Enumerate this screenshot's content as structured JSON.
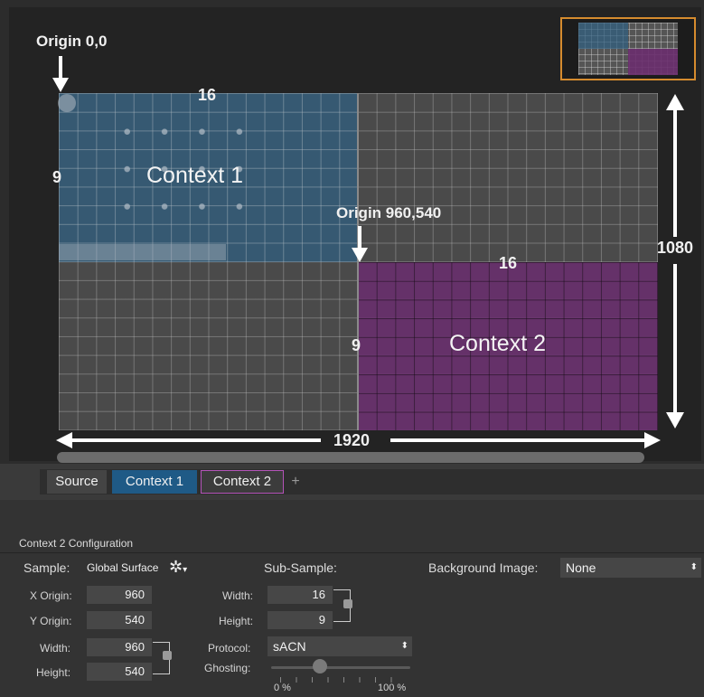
{
  "annotations": {
    "origin_top": "Origin 0,0",
    "origin_mid": "Origin 960,540",
    "ctx1_cols": "16",
    "ctx1_rows": "9",
    "ctx1_label": "Context 1",
    "ctx2_cols": "16",
    "ctx2_rows": "9",
    "ctx2_label": "Context 2",
    "height_label": "1080",
    "width_label": "1920"
  },
  "colors": {
    "context1": "#2f5f82",
    "context2": "#6a2d6e",
    "accent_tab1": "#1f5a86",
    "accent_tab2": "#b453b8"
  },
  "tabs": [
    "Source",
    "Context 1",
    "Context 2"
  ],
  "add_tab_icon": "plus-icon",
  "config": {
    "title": "Context 2 Configuration",
    "sample_label": "Sample:",
    "sample_value": "Global Surface",
    "sample_icon": "gear-icon",
    "subsample_label": "Sub-Sample:",
    "bg_image_label": "Background Image:",
    "bg_image_value": "None",
    "x_origin_label": "X Origin:",
    "x_origin_value": "960",
    "y_origin_label": "Y Origin:",
    "y_origin_value": "540",
    "width_label": "Width:",
    "width_value": "960",
    "height_label": "Height:",
    "height_value": "540",
    "sub_width_label": "Width:",
    "sub_width_value": "16",
    "sub_height_label": "Height:",
    "sub_height_value": "9",
    "protocol_label": "Protocol:",
    "protocol_value": "sACN",
    "ghosting_label": "Ghosting:",
    "ghosting_min": "0 %",
    "ghosting_max": "100 %",
    "ghosting_level": 0.35
  }
}
